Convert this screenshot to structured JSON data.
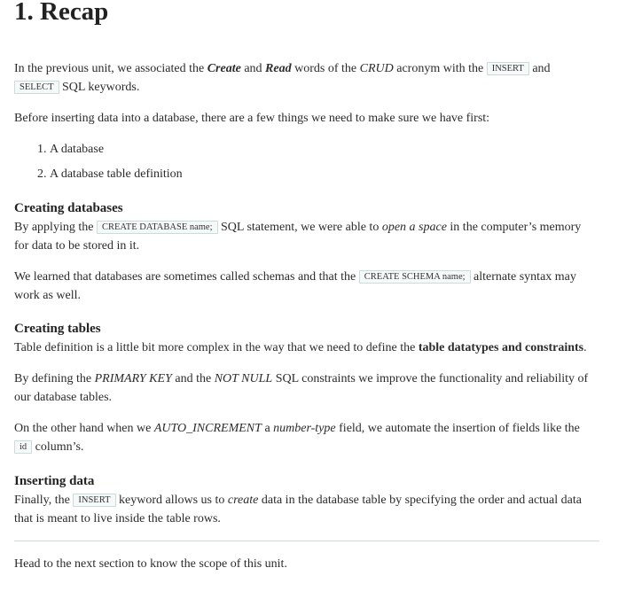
{
  "title": "1. Recap",
  "intro": {
    "t1": "In the previous unit, we associated the ",
    "create": "Create",
    "t2": " and ",
    "read": "Read",
    "t3": " words of the ",
    "crud": "CRUD",
    "t4": " acronym with the ",
    "insert_code": "INSERT",
    "t5": " and",
    "select_code": "SELECT",
    "t6": " SQL keywords."
  },
  "before": "Before inserting data into a database, there are a few things we need to make sure we have first:",
  "list": [
    {
      "num": "1.",
      "text": "A database"
    },
    {
      "num": "2.",
      "text": "A database table definition"
    }
  ],
  "creating_databases": {
    "heading": "Creating databases",
    "p1": {
      "t1": "By applying the ",
      "code": "CREATE DATABASE name;",
      "t2": " SQL statement, we were able to ",
      "em": "open a space",
      "t3": " in the computer’s memory",
      "t4": "for data to be stored in it."
    },
    "p2": {
      "t1": "We learned that databases are sometimes called schemas and that the ",
      "code": "CREATE SCHEMA name;",
      "t2": " alternate syntax may",
      "t3": "work as well."
    }
  },
  "creating_tables": {
    "heading": "Creating tables",
    "p1": {
      "t1": "Table definition is a little bit more complex in the way that we need to define the ",
      "strong": "table datatypes and constraints",
      "t2": "."
    },
    "p2": {
      "t1": "By defining the ",
      "em1": "PRIMARY KEY",
      "t2": " and the ",
      "em2": "NOT NULL",
      "t3": " SQL constraints we improve the functionality and reliability of",
      "t4": "our database tables."
    },
    "p3": {
      "t1": "On the other hand when we ",
      "em1": "AUTO_INCREMENT",
      "t2": " a ",
      "em2": "number-type",
      "t3": " field, we automate the insertion of fields like the",
      "code": "id",
      "t4": " column’s."
    }
  },
  "inserting_data": {
    "heading": "Inserting data",
    "p1": {
      "t1": "Finally, the ",
      "code": "INSERT",
      "t2": " keyword allows us to ",
      "em": "create",
      "t3": " data in the database table by specifying the order and actual data",
      "t4": "that is meant to live inside the table rows."
    }
  },
  "footer": "Head to the next section to know the scope of this unit."
}
